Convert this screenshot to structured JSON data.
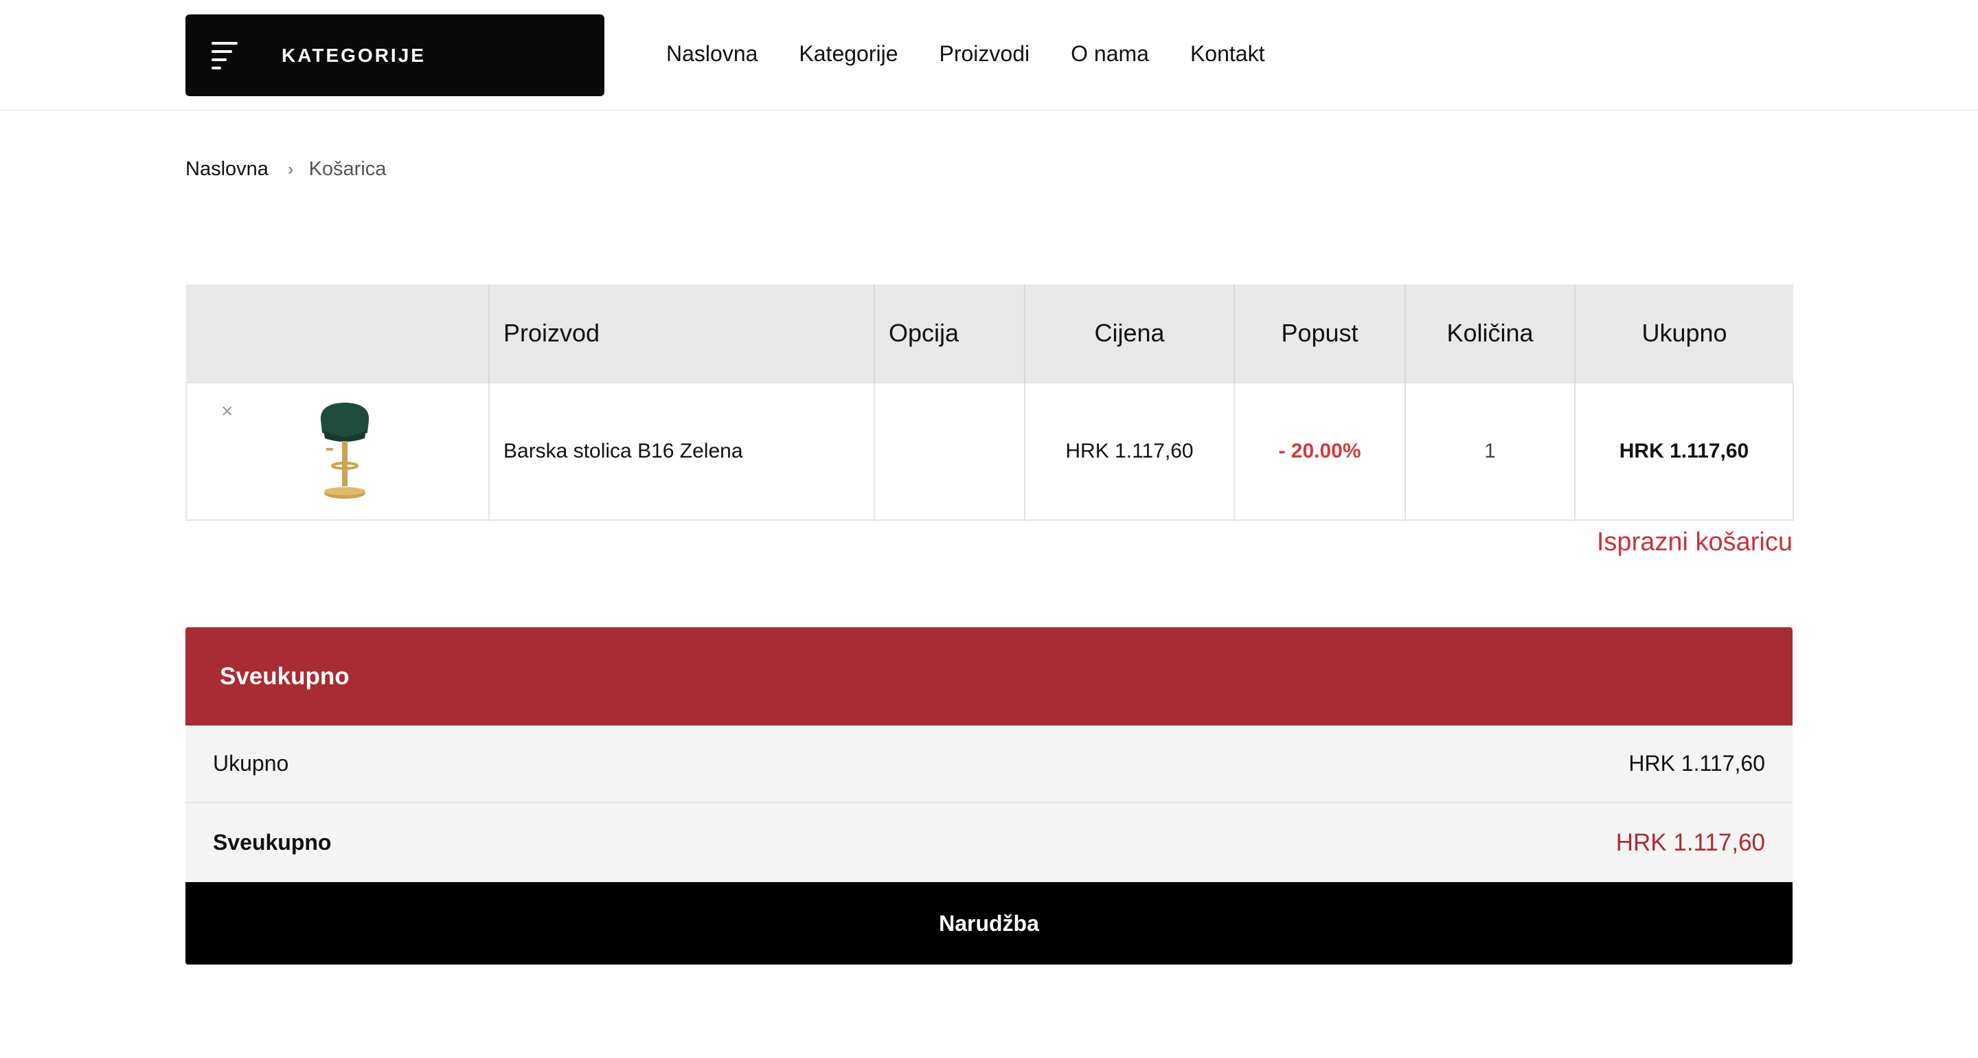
{
  "header": {
    "categories_button": "KATEGORIJE",
    "nav": [
      "Naslovna",
      "Kategorije",
      "Proizvodi",
      "O nama",
      "Kontakt"
    ]
  },
  "breadcrumb": {
    "home": "Naslovna",
    "separator": "›",
    "current": "Košarica"
  },
  "cart": {
    "columns": [
      "",
      "Proizvod",
      "Opcija",
      "Cijena",
      "Popust",
      "Količina",
      "Ukupno"
    ],
    "items": [
      {
        "remove_icon": "close-icon",
        "remove": "×",
        "image_icon": "bar-stool-image",
        "product": "Barska stolica B16 Zelena",
        "option": "",
        "price": "HRK 1.117,60",
        "discount": "- 20.00%",
        "quantity": "1",
        "total": "HRK 1.117,60"
      }
    ],
    "empty_cart": "Isprazni košaricu"
  },
  "summary": {
    "title": "Sveukupno",
    "subtotal_label": "Ukupno",
    "subtotal_value": "HRK 1.117,60",
    "grand_label": "Sveukupno",
    "grand_value": "HRK 1.117,60",
    "order_button": "Narudžba"
  },
  "colors": {
    "accent": "#a92b33",
    "discount": "#d23a3f",
    "dark": "#0a0a0a"
  }
}
